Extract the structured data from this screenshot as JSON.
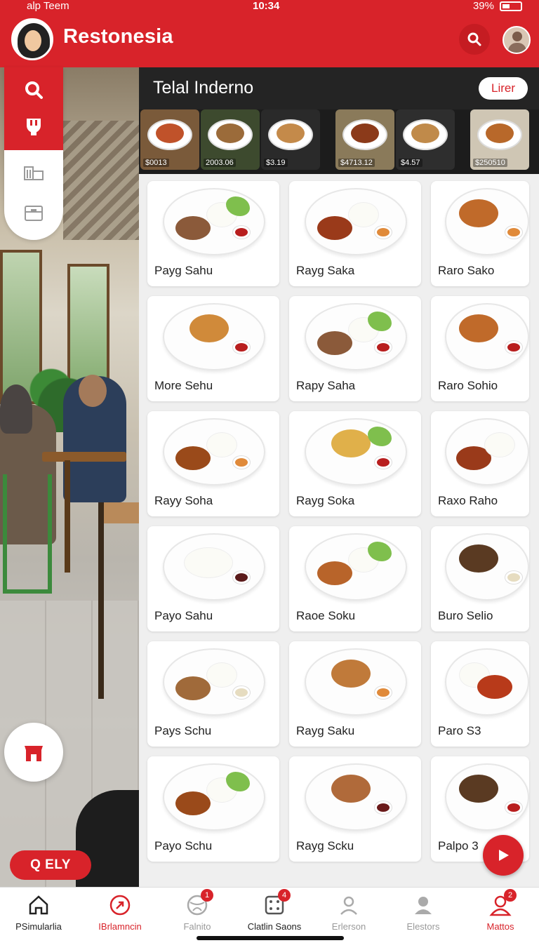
{
  "status_bar": {
    "carrier": "alp Teem",
    "time": "10:34",
    "battery": "39%"
  },
  "header": {
    "title": "Restonesia",
    "search_icon": "search-icon",
    "profile_icon": "profile-avatar"
  },
  "colors": {
    "brand_red": "#d8232a",
    "dark_bar": "#242424"
  },
  "side_rail": {
    "items": [
      {
        "icon": "search-icon"
      },
      {
        "icon": "food-icon"
      },
      {
        "icon": "building-icon"
      },
      {
        "icon": "archive-icon"
      }
    ]
  },
  "left_fab": {
    "icon": "shop-icon"
  },
  "qely_button": {
    "label": "Q ELY"
  },
  "hero": {
    "title": "Telal Inderno",
    "button_label": "Lirer"
  },
  "strip": {
    "items": [
      {
        "price": "$0013"
      },
      {
        "price": "2003.06"
      },
      {
        "price": "$3.19"
      },
      {
        "price": "$4713.12"
      },
      {
        "price": "$4.57"
      },
      {
        "price": "$250510"
      }
    ]
  },
  "menu_items": [
    {
      "name": "Payg Sahu"
    },
    {
      "name": "Rayg Saka"
    },
    {
      "name": "Raro Sako"
    },
    {
      "name": "More Sehu"
    },
    {
      "name": "Rapy Saha"
    },
    {
      "name": "Raro Sohio"
    },
    {
      "name": "Rayy Soha"
    },
    {
      "name": "Rayg Soka"
    },
    {
      "name": "Raxo Raho"
    },
    {
      "name": "Payo Sahu"
    },
    {
      "name": "Raoe Soku"
    },
    {
      "name": "Buro Selio"
    },
    {
      "name": "Pays Schu"
    },
    {
      "name": "Rayg Saku"
    },
    {
      "name": "Paro S3"
    },
    {
      "name": "Payo Schu"
    },
    {
      "name": "Rayg Scku"
    },
    {
      "name": "Palpo 3"
    }
  ],
  "play_fab": {
    "icon": "play-icon"
  },
  "bottom_nav": {
    "items": [
      {
        "label": "PSimularlia",
        "icon": "home-icon"
      },
      {
        "label": "IBrlamncin",
        "icon": "arrow-circle-icon"
      },
      {
        "label": "Falnito",
        "icon": "globe-icon",
        "badge": "1"
      },
      {
        "label": "Clatlin Saons",
        "icon": "grid-icon",
        "badge": "4"
      },
      {
        "label": "Erlerson",
        "icon": "user-outline-icon"
      },
      {
        "label": "Elestors",
        "icon": "user-icon"
      },
      {
        "label": "Mattos",
        "icon": "user-red-icon",
        "badge": "2"
      }
    ]
  }
}
